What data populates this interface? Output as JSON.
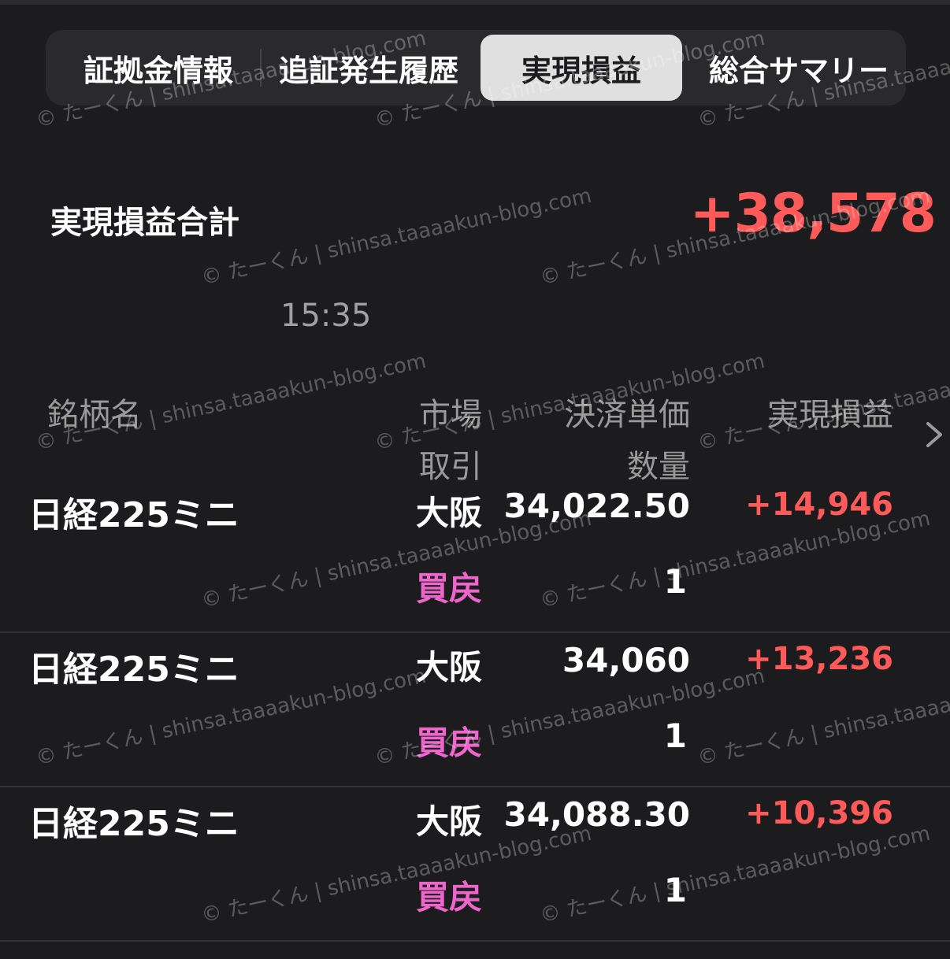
{
  "tabs": [
    {
      "label": "証拠金情報",
      "active": false
    },
    {
      "label": "追証発生履歴",
      "active": false
    },
    {
      "label": "実現損益",
      "active": true
    },
    {
      "label": "総合サマリー",
      "active": false
    }
  ],
  "summary": {
    "label": "実現損益合計",
    "value": "+38,578",
    "time": "15:35"
  },
  "columns": {
    "name": "銘柄名",
    "market": "市場",
    "trade": "取引",
    "price": "決済単価",
    "qty": "数量",
    "pnl": "実現損益"
  },
  "rows": [
    {
      "name": "日経225ミニ",
      "market": "大阪",
      "trade": "買戻",
      "price": "34,022.50",
      "qty": "1",
      "pnl": "+14,946"
    },
    {
      "name": "日経225ミニ",
      "market": "大阪",
      "trade": "買戻",
      "price": "34,060",
      "qty": "1",
      "pnl": "+13,236"
    },
    {
      "name": "日経225ミニ",
      "market": "大阪",
      "trade": "買戻",
      "price": "34,088.30",
      "qty": "1",
      "pnl": "+10,396"
    }
  ],
  "watermark": {
    "line1": "shinsa.taaaakun-blog.com",
    "line2": "© たーくん"
  },
  "colors": {
    "positive": "#ff5a5a",
    "trade_type": "#ee66cc",
    "background": "#1c1c1e"
  }
}
